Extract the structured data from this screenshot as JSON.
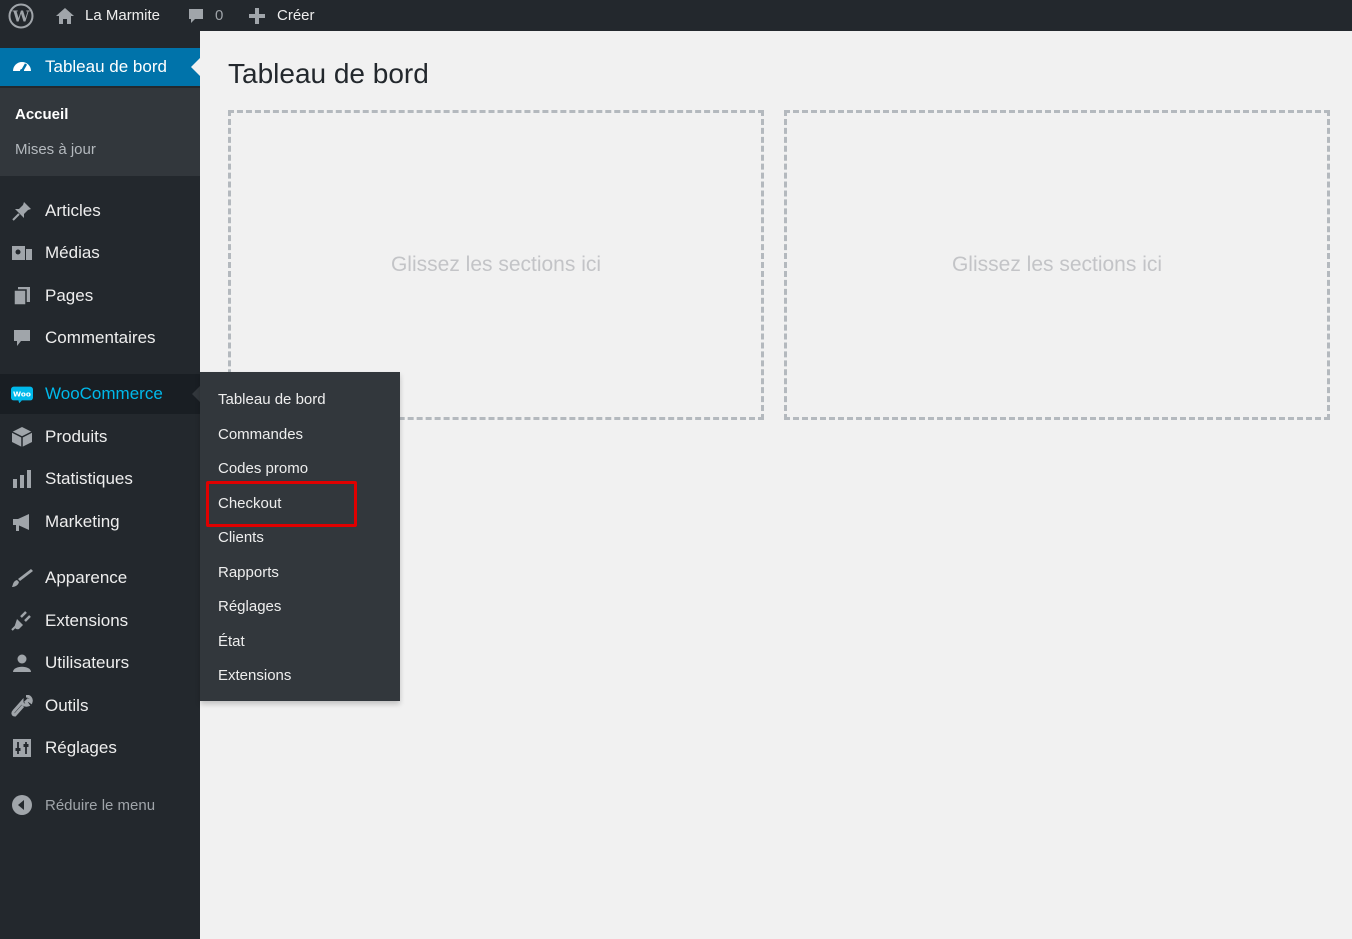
{
  "adminbar": {
    "site_name": "La Marmite",
    "comments_count": "0",
    "create_label": "Créer"
  },
  "sidebar": {
    "current": {
      "label": "Tableau de bord",
      "icon": "dashboard-icon"
    },
    "submenu": [
      {
        "label": "Accueil",
        "active": true
      },
      {
        "label": "Mises à jour",
        "active": false
      }
    ],
    "items": [
      {
        "label": "Articles",
        "icon": "pin-icon"
      },
      {
        "label": "Médias",
        "icon": "media-icon"
      },
      {
        "label": "Pages",
        "icon": "pages-icon"
      },
      {
        "label": "Commentaires",
        "icon": "comment-icon"
      },
      {
        "label": "WooCommerce",
        "icon": "woo-icon"
      },
      {
        "label": "Produits",
        "icon": "box-icon"
      },
      {
        "label": "Statistiques",
        "icon": "bar-chart-icon"
      },
      {
        "label": "Marketing",
        "icon": "megaphone-icon"
      },
      {
        "label": "Apparence",
        "icon": "brush-icon"
      },
      {
        "label": "Extensions",
        "icon": "plugin-icon"
      },
      {
        "label": "Utilisateurs",
        "icon": "user-icon"
      },
      {
        "label": "Outils",
        "icon": "wrench-icon"
      },
      {
        "label": "Réglages",
        "icon": "settings-icon"
      }
    ],
    "collapse_label": "Réduire le menu"
  },
  "flyout": {
    "items": [
      "Tableau de bord",
      "Commandes",
      "Codes promo",
      "Checkout",
      "Clients",
      "Rapports",
      "Réglages",
      "État",
      "Extensions"
    ],
    "highlighted": "Checkout"
  },
  "main": {
    "title": "Tableau de bord",
    "dropzones": [
      "Glissez les sections ici",
      "Glissez les sections ici"
    ]
  },
  "colors": {
    "admin_dark": "#23282d",
    "accent": "#0073aa",
    "woo_accent": "#00b9eb",
    "highlight": "#e00000"
  }
}
